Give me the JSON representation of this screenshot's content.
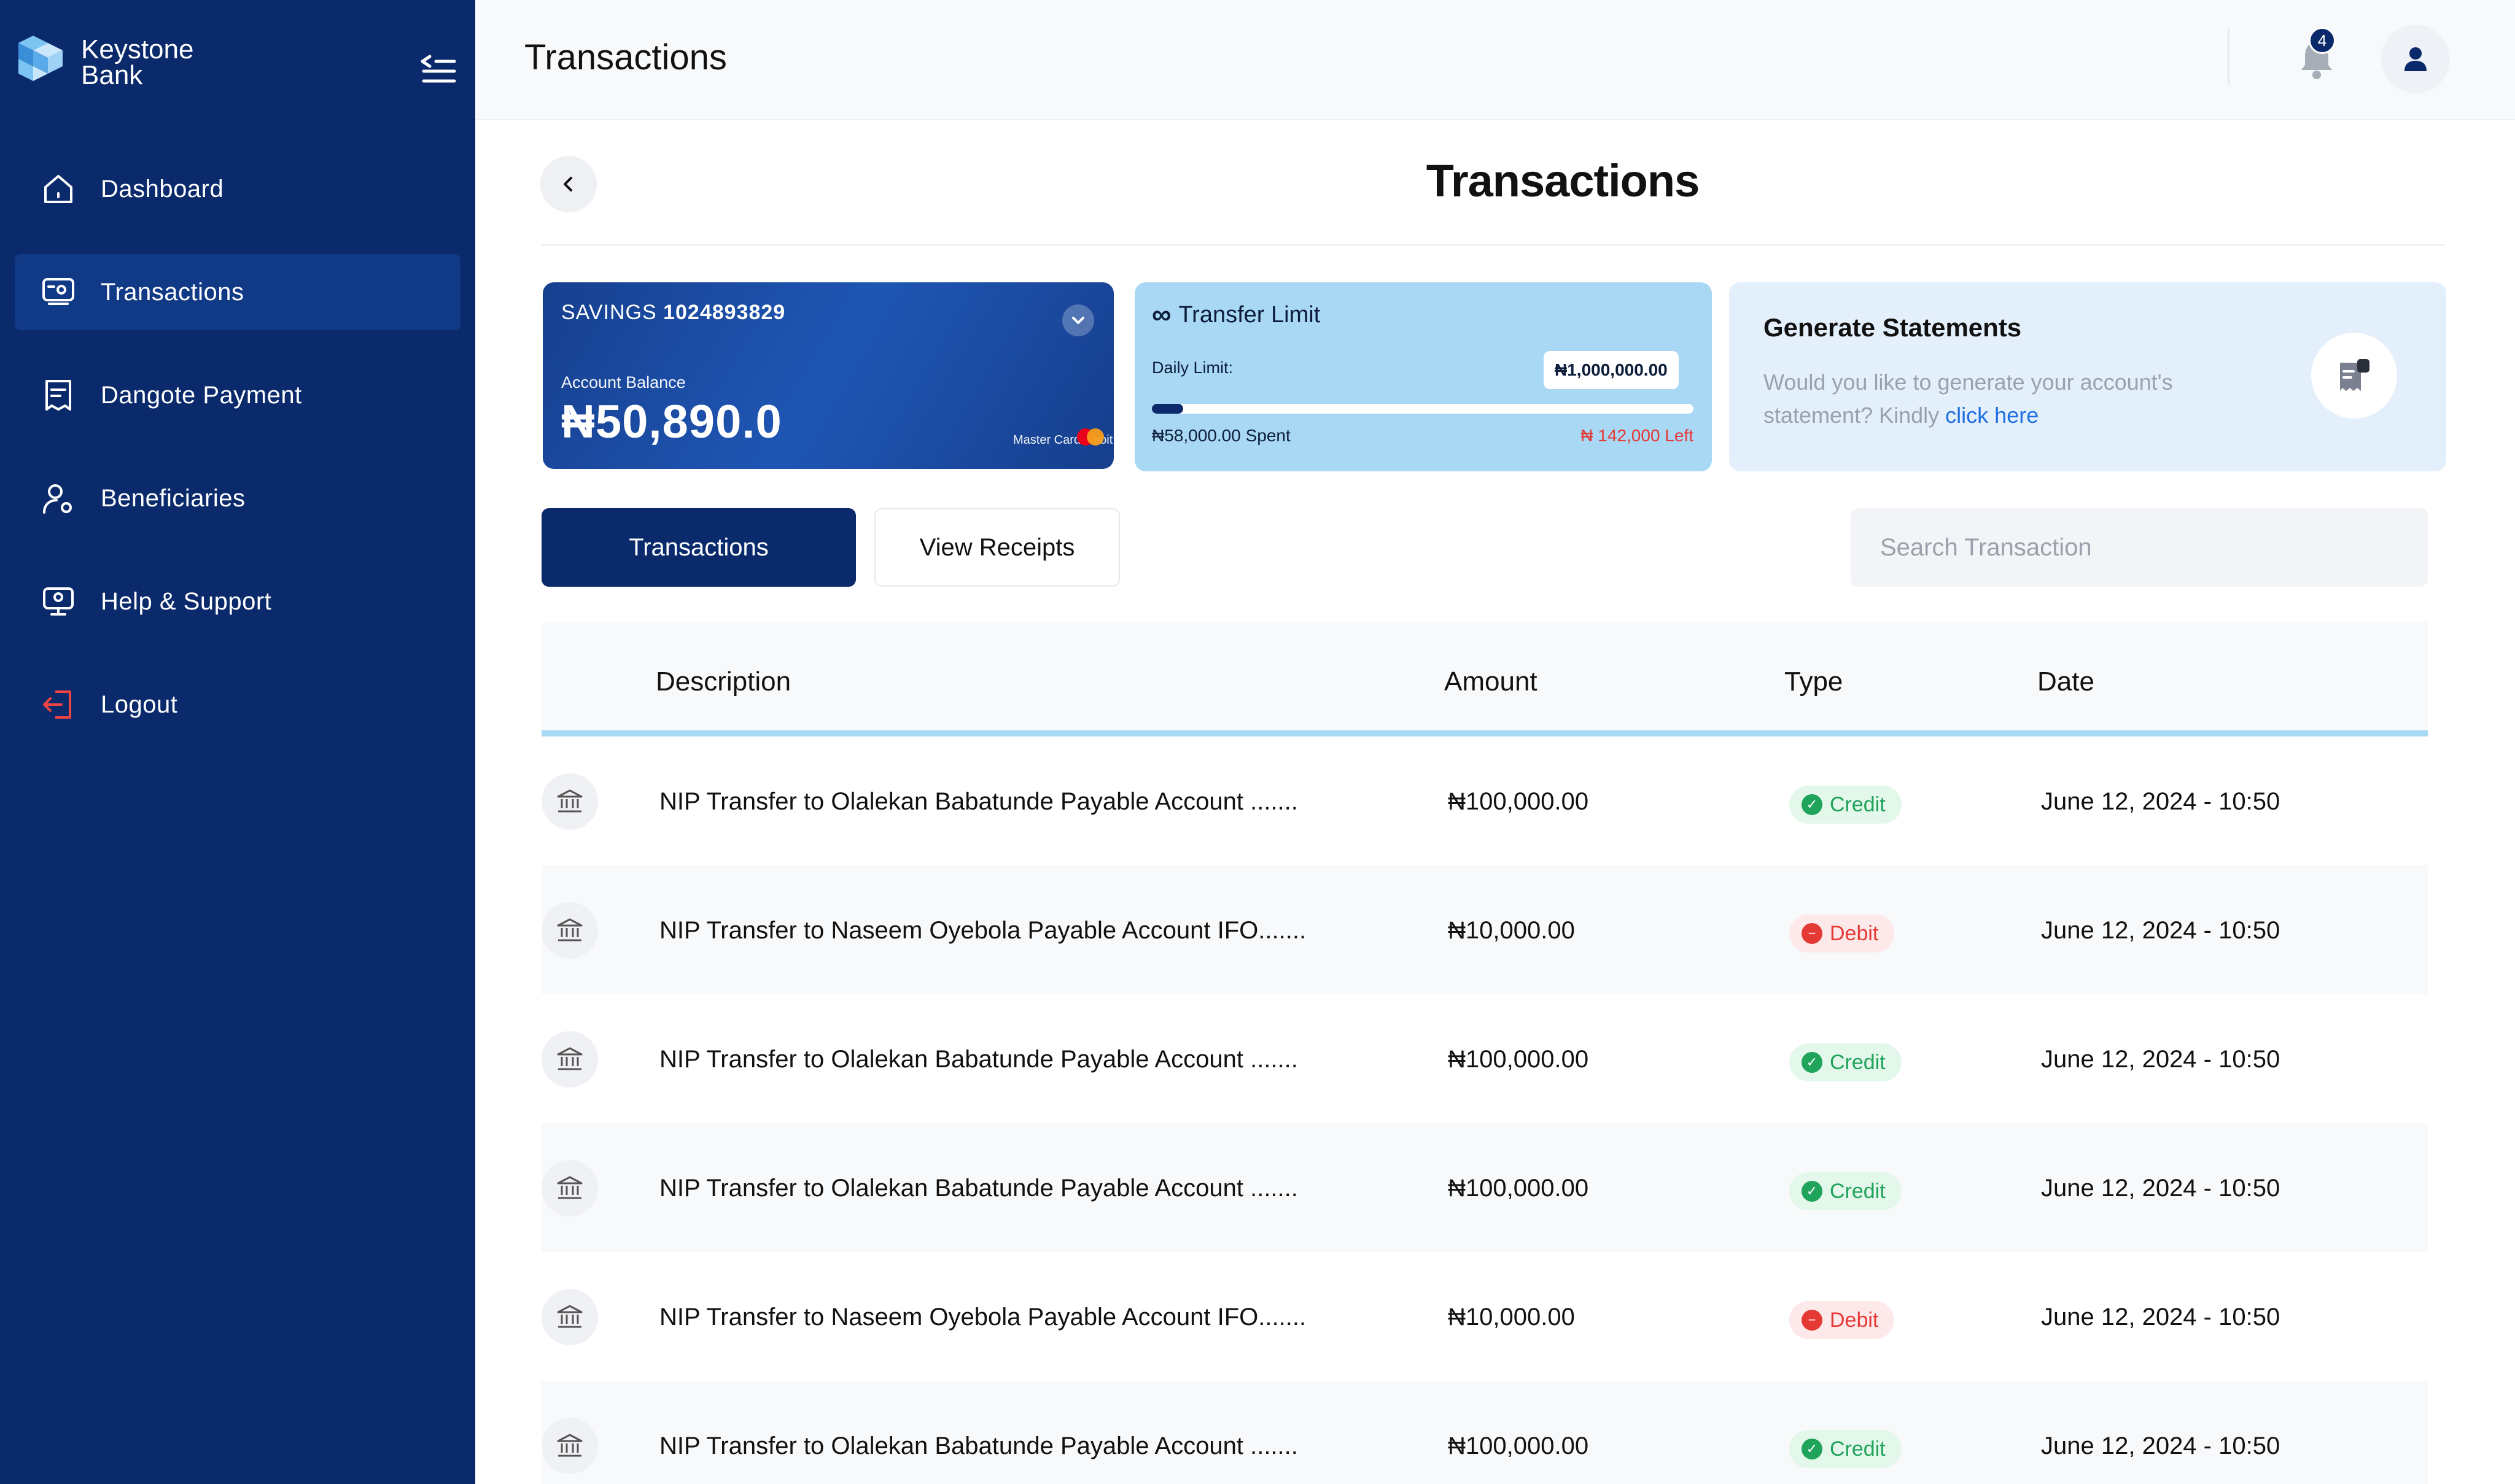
{
  "brand": {
    "name_line1": "Keystone",
    "name_line2": "Bank"
  },
  "sidebar": {
    "items": [
      {
        "label": "Dashboard",
        "icon": "home-icon"
      },
      {
        "label": "Transactions",
        "icon": "transactions-icon",
        "active": true
      },
      {
        "label": "Dangote Payment",
        "icon": "receipt-icon"
      },
      {
        "label": "Beneficiaries",
        "icon": "user-settings-icon"
      },
      {
        "label": "Help & Support",
        "icon": "support-icon"
      },
      {
        "label": "Logout",
        "icon": "logout-icon"
      }
    ]
  },
  "topbar": {
    "title": "Transactions",
    "notifications_count": "4"
  },
  "main": {
    "title": "Transactions"
  },
  "savings_card": {
    "account_type": "SAVINGS",
    "account_number": "1024893829",
    "balance_label": "Account Balance",
    "balance": "₦50,890.0",
    "card_label": "Master Card Debit"
  },
  "transfer_limit": {
    "title": "Transfer Limit",
    "daily_label": "Daily Limit:",
    "daily_amount": "₦1,000,000.00",
    "spent": "₦58,000.00 Spent",
    "left": "₦ 142,000 Left",
    "progress_fraction": 0.058
  },
  "statements": {
    "title": "Generate Statements",
    "text": "Would you like to generate your account's statement? Kindly",
    "link": "click here"
  },
  "tabs": {
    "primary": "Transactions",
    "secondary": "View Receipts"
  },
  "search": {
    "placeholder": "Search Transaction"
  },
  "table": {
    "headers": {
      "description": "Description",
      "amount": "Amount",
      "type": "Type",
      "date": "Date"
    },
    "rows": [
      {
        "description": "NIP Transfer to Olalekan Babatunde Payable Account .......",
        "amount": "₦100,000.00",
        "type": "Credit",
        "date": "June 12, 2024 - 10:50"
      },
      {
        "description": "NIP Transfer to Naseem Oyebola Payable Account IFO.......",
        "amount": "₦10,000.00",
        "type": "Debit",
        "date": "June 12, 2024 - 10:50"
      },
      {
        "description": "NIP Transfer to Olalekan Babatunde Payable Account .......",
        "amount": "₦100,000.00",
        "type": "Credit",
        "date": "June 12, 2024 - 10:50"
      },
      {
        "description": "NIP Transfer to Olalekan Babatunde Payable Account .......",
        "amount": "₦100,000.00",
        "type": "Credit",
        "date": "June 12, 2024 - 10:50"
      },
      {
        "description": "NIP Transfer to Naseem Oyebola Payable Account IFO.......",
        "amount": "₦10,000.00",
        "type": "Debit",
        "date": "June 12, 2024 - 10:50"
      },
      {
        "description": "NIP Transfer to Olalekan Babatunde Payable Account .......",
        "amount": "₦100,000.00",
        "type": "Credit",
        "date": "June 12, 2024 - 10:50"
      }
    ]
  },
  "colors": {
    "brand_navy": "#0a2a6b",
    "accent_light_blue": "#a9d8f5",
    "credit_green": "#20a35a",
    "debit_red": "#e53935"
  }
}
